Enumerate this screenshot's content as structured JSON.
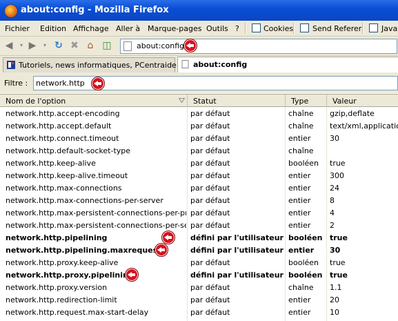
{
  "window": {
    "title": "about:config - Mozilla Firefox"
  },
  "menu": {
    "items": [
      "Fichier",
      "Edition",
      "Affichage",
      "Aller à",
      "Marque-pages",
      "Outils",
      "?"
    ],
    "checkboxes": [
      {
        "label": "Cookies",
        "checked": false
      },
      {
        "label": "Send Referer",
        "checked": false
      },
      {
        "label": "Java",
        "checked": false
      }
    ]
  },
  "nav": {
    "url": "about:config"
  },
  "tabs": [
    {
      "label": "Tutoriels, news informatiques, PCentraide",
      "active": false
    },
    {
      "label": "about:config",
      "active": true
    }
  ],
  "filter": {
    "label": "Filtre :",
    "value": "network.http"
  },
  "table": {
    "columns": [
      "Nom de l'option",
      "Statut",
      "Type",
      "Valeur"
    ],
    "rows": [
      {
        "name": "network.http.accept-encoding",
        "status": "par défaut",
        "type": "chaîne",
        "value": "gzip,deflate",
        "bold": false
      },
      {
        "name": "network.http.accept.default",
        "status": "par défaut",
        "type": "chaîne",
        "value": "text/xml,application/xml,application/xhtml+xml,text/html",
        "bold": false
      },
      {
        "name": "network.http.connect.timeout",
        "status": "par défaut",
        "type": "entier",
        "value": "30",
        "bold": false
      },
      {
        "name": "network.http.default-socket-type",
        "status": "par défaut",
        "type": "chaîne",
        "value": "",
        "bold": false
      },
      {
        "name": "network.http.keep-alive",
        "status": "par défaut",
        "type": "booléen",
        "value": "true",
        "bold": false
      },
      {
        "name": "network.http.keep-alive.timeout",
        "status": "par défaut",
        "type": "entier",
        "value": "300",
        "bold": false
      },
      {
        "name": "network.http.max-connections",
        "status": "par défaut",
        "type": "entier",
        "value": "24",
        "bold": false
      },
      {
        "name": "network.http.max-connections-per-server",
        "status": "par défaut",
        "type": "entier",
        "value": "8",
        "bold": false
      },
      {
        "name": "network.http.max-persistent-connections-per-proxy",
        "status": "par défaut",
        "type": "entier",
        "value": "4",
        "bold": false
      },
      {
        "name": "network.http.max-persistent-connections-per-server",
        "status": "par défaut",
        "type": "entier",
        "value": "2",
        "bold": false
      },
      {
        "name": "network.http.pipelining",
        "status": "défini par l'utilisateur",
        "type": "booléen",
        "value": "true",
        "bold": true
      },
      {
        "name": "network.http.pipelining.maxrequests",
        "status": "défini par l'utilisateur",
        "type": "entier",
        "value": "30",
        "bold": true
      },
      {
        "name": "network.http.proxy.keep-alive",
        "status": "par défaut",
        "type": "booléen",
        "value": "true",
        "bold": false
      },
      {
        "name": "network.http.proxy.pipelining",
        "status": "défini par l'utilisateur",
        "type": "booléen",
        "value": "true",
        "bold": true
      },
      {
        "name": "network.http.proxy.version",
        "status": "par défaut",
        "type": "chaîne",
        "value": "1.1",
        "bold": false
      },
      {
        "name": "network.http.redirection-limit",
        "status": "par défaut",
        "type": "entier",
        "value": "20",
        "bold": false
      },
      {
        "name": "network.http.request.max-start-delay",
        "status": "par défaut",
        "type": "entier",
        "value": "10",
        "bold": false
      }
    ]
  }
}
